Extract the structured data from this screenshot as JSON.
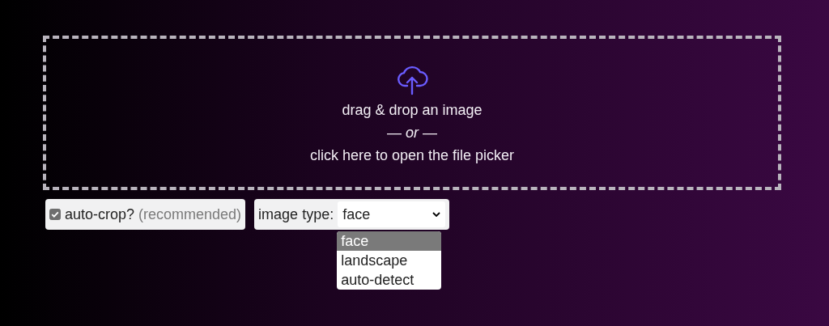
{
  "dropzone": {
    "lines": [
      "drag & drop an image",
      "— *or* —",
      "click here to open the file picker"
    ]
  },
  "auto_crop": {
    "label": "auto-crop?",
    "hint": "(recommended)",
    "checked": true
  },
  "image_type": {
    "label": "image type:",
    "value": "face",
    "options": [
      {
        "label": "face",
        "selected": true
      },
      {
        "label": "landscape",
        "selected": false
      },
      {
        "label": "auto-detect",
        "selected": false
      }
    ]
  }
}
